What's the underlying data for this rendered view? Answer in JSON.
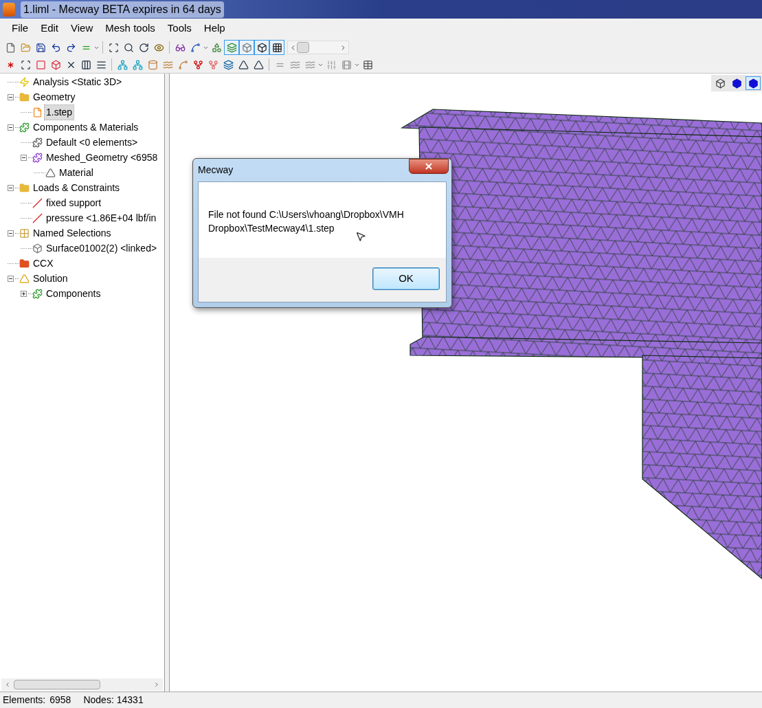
{
  "window": {
    "title": "1.liml - Mecway BETA expires in 64 days"
  },
  "menu": [
    "File",
    "Edit",
    "View",
    "Mesh tools",
    "Tools",
    "Help"
  ],
  "tree": [
    {
      "label": "Analysis <Static 3D>",
      "kind": "analysis",
      "selected": false
    },
    {
      "label": "Geometry",
      "kind": "folder",
      "selected": false,
      "expanded": true,
      "children": [
        {
          "label": "1.step",
          "kind": "step",
          "selected": true
        }
      ]
    },
    {
      "label": "Components & Materials",
      "kind": "components",
      "selected": false,
      "expanded": true,
      "children": [
        {
          "label": "Default <0 elements>",
          "kind": "puzzle",
          "selected": false
        },
        {
          "label": "Meshed_Geometry <6958",
          "kind": "puzzle-purple",
          "selected": false,
          "expanded": true,
          "children": [
            {
              "label": "Material",
              "kind": "material",
              "selected": false
            }
          ]
        }
      ]
    },
    {
      "label": "Loads & Constraints",
      "kind": "loads",
      "selected": false,
      "expanded": true,
      "children": [
        {
          "label": "fixed support",
          "kind": "load",
          "selected": false
        },
        {
          "label": "pressure <1.86E+04 lbf/in",
          "kind": "load",
          "selected": false
        }
      ]
    },
    {
      "label": "Named Selections",
      "kind": "selections",
      "selected": false,
      "expanded": true,
      "children": [
        {
          "label": "Surface01002(2) <linked>",
          "kind": "surface",
          "selected": false
        }
      ]
    },
    {
      "label": "CCX",
      "kind": "ccx",
      "selected": false
    },
    {
      "label": "Solution",
      "kind": "solution",
      "selected": false,
      "expanded": true,
      "children": [
        {
          "label": "Components",
          "kind": "components",
          "selected": false,
          "expanded": false
        }
      ]
    }
  ],
  "view_buttons": [
    {
      "selected": false
    },
    {
      "selected": false
    },
    {
      "selected": true
    }
  ],
  "dialog": {
    "title": "Mecway",
    "message": "File not found C:\\Users\\vhoang\\Dropbox\\VMH Dropbox\\TestMecway4\\1.step",
    "button": "OK"
  },
  "status_bar": {
    "elements_label": "Elements:",
    "elements": "6958",
    "nodes_label": "Nodes:",
    "nodes": "14331"
  }
}
